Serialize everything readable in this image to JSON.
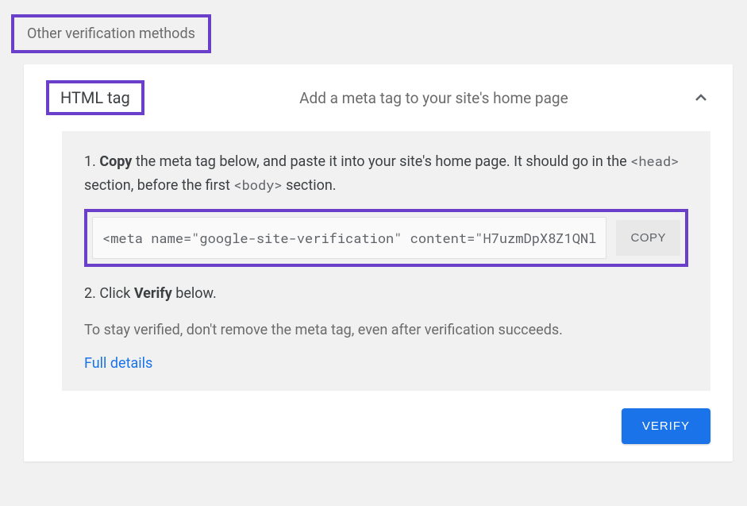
{
  "section_title": "Other verification methods",
  "method": {
    "name": "HTML tag",
    "description": "Add a meta tag to your site's home page"
  },
  "step1": {
    "prefix": "1. ",
    "bold": "Copy",
    "text_a": " the meta tag below, and paste it into your site's home page. It should go in the ",
    "code_head": "<head>",
    "text_b": " section, before the first ",
    "code_body": "<body>",
    "text_c": " section."
  },
  "meta_tag_value": "<meta name=\"google-site-verification\" content=\"H7uzmDpX8Z1QNl",
  "copy_label": "COPY",
  "step2": {
    "prefix": "2. Click ",
    "bold": "Verify",
    "suffix": " below."
  },
  "note": "To stay verified, don't remove the meta tag, even after verification succeeds.",
  "full_details_label": "Full details",
  "verify_label": "VERIFY"
}
